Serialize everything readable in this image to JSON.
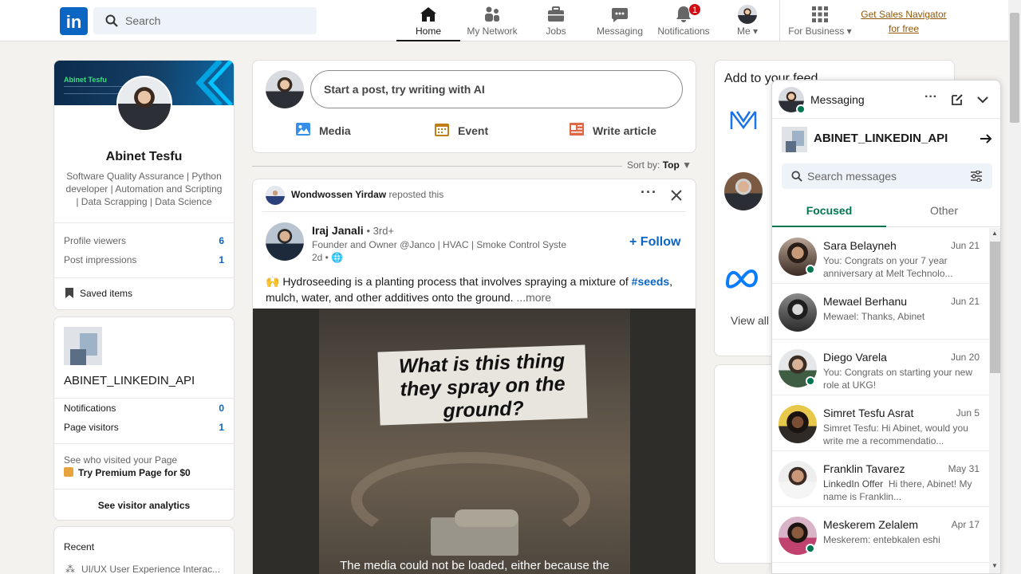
{
  "nav": {
    "search_placeholder": "Search",
    "items": [
      {
        "label": "Home",
        "icon": "home-icon"
      },
      {
        "label": "My Network",
        "icon": "network-icon"
      },
      {
        "label": "Jobs",
        "icon": "jobs-icon"
      },
      {
        "label": "Messaging",
        "icon": "messaging-icon"
      },
      {
        "label": "Notifications",
        "icon": "bell-icon",
        "badge": "1"
      },
      {
        "label": "Me",
        "icon": "avatar"
      },
      {
        "label": "For Business",
        "icon": "grid-icon"
      }
    ],
    "sales_line1": "Get Sales Navigator",
    "sales_line2": "for free",
    "logo": "in"
  },
  "profile": {
    "banner_name": "Abinet Tesfu",
    "name": "Abinet Tesfu",
    "headline": "Software Quality Assurance | Python developer | Automation and Scripting | Data Scrapping | Data Science",
    "stats": [
      {
        "label": "Profile viewers",
        "value": "6"
      },
      {
        "label": "Post impressions",
        "value": "1"
      }
    ],
    "saved_label": "Saved items"
  },
  "page_card": {
    "name": "ABINET_LINKEDIN_API",
    "stats": [
      {
        "label": "Notifications",
        "value": "0"
      },
      {
        "label": "Page visitors",
        "value": "1"
      }
    ],
    "premium_line1": "See who visited your Page",
    "premium_line2": "Try Premium Page for $0",
    "analytics_label": "See visitor analytics"
  },
  "recent": {
    "title": "Recent",
    "item": "UI/UX User Experience Interac..."
  },
  "composer": {
    "placeholder": "Start a post, try writing with AI",
    "media": "Media",
    "event": "Event",
    "article": "Write article"
  },
  "sort": {
    "label": "Sort by:",
    "value": "Top"
  },
  "post": {
    "reposter": "Wondwossen Yirdaw",
    "repost_text": "reposted this",
    "author": "Iraj Janali",
    "degree": "• 3rd+",
    "headline": "Founder and Owner @Janco | HVAC | Smoke Control Syste...",
    "time": "2d •",
    "follow": "Follow",
    "text_prefix": "🙌 Hydroseeding is a planting process that involves spraying a mixture of ",
    "hashtag": "#seeds",
    "text_suffix": ", mulch, water, and other additives onto the ground.",
    "more": "...more",
    "video_caption": "What is this thing they spray on the ground?",
    "video_error": "The media could not be loaded, either because the"
  },
  "right": {
    "title": "Add to your feed",
    "view_all": "View all"
  },
  "messaging": {
    "title": "Messaging",
    "page_name": "ABINET_LINKEDIN_API",
    "search_placeholder": "Search messages",
    "tabs": [
      "Focused",
      "Other"
    ],
    "conversations": [
      {
        "name": "Sara Belayneh",
        "date": "Jun 21",
        "preview": "You: Congrats on your 7 year anniversary at Melt Technolo...",
        "online": true
      },
      {
        "name": "Mewael Berhanu",
        "date": "Jun 21",
        "preview": "Mewael: Thanks, Abinet",
        "online": false
      },
      {
        "name": "Diego Varela",
        "date": "Jun 20",
        "preview": "You: Congrats on starting your new role at UKG!",
        "online": true
      },
      {
        "name": "Simret Tesfu Asrat",
        "date": "Jun 5",
        "preview": "Simret Tesfu: Hi Abinet, would you write me a recommendatio...",
        "online": false
      },
      {
        "name": "Franklin Tavarez",
        "date": "May 31",
        "tag": "LinkedIn Offer",
        "preview": "Hi there, Abinet! My name is Franklin...",
        "online": false
      },
      {
        "name": "Meskerem Zelalem",
        "date": "Apr 17",
        "preview": "Meskerem: entebkalen eshi",
        "online": true
      }
    ]
  }
}
